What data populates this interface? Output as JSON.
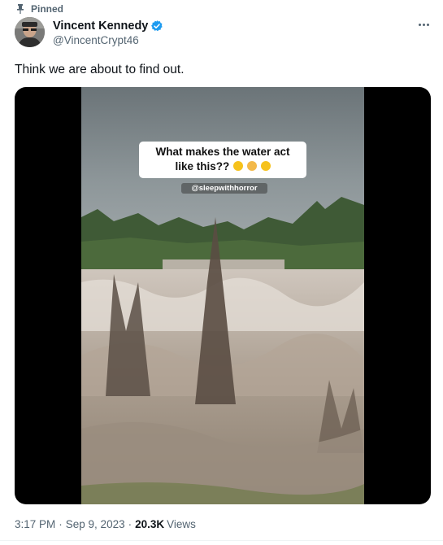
{
  "tweet": {
    "pinned_label": "Pinned",
    "author": {
      "display_name": "Vincent Kennedy",
      "handle": "@VincentCrypt46"
    },
    "text": "Think we are about to find out.",
    "media": {
      "caption_line1": "What makes the water act",
      "caption_line2": "like this??",
      "caption_emojis": [
        "grinning-squinting-emoji",
        "screaming-emoji",
        "grinning-emoji"
      ],
      "watermark": "@sleepwithhorror"
    },
    "time": "3:17 PM",
    "date": "Sep 9, 2023",
    "separator": "·",
    "views_count": "20.3K",
    "views_label": "Views"
  },
  "colors": {
    "verified_badge": "#1d9bf0",
    "secondary_text": "#536471",
    "primary_text": "#0f1419"
  },
  "icons": {
    "pin": "pin-icon",
    "verified": "verified-badge-icon",
    "more": "more-options-icon"
  }
}
